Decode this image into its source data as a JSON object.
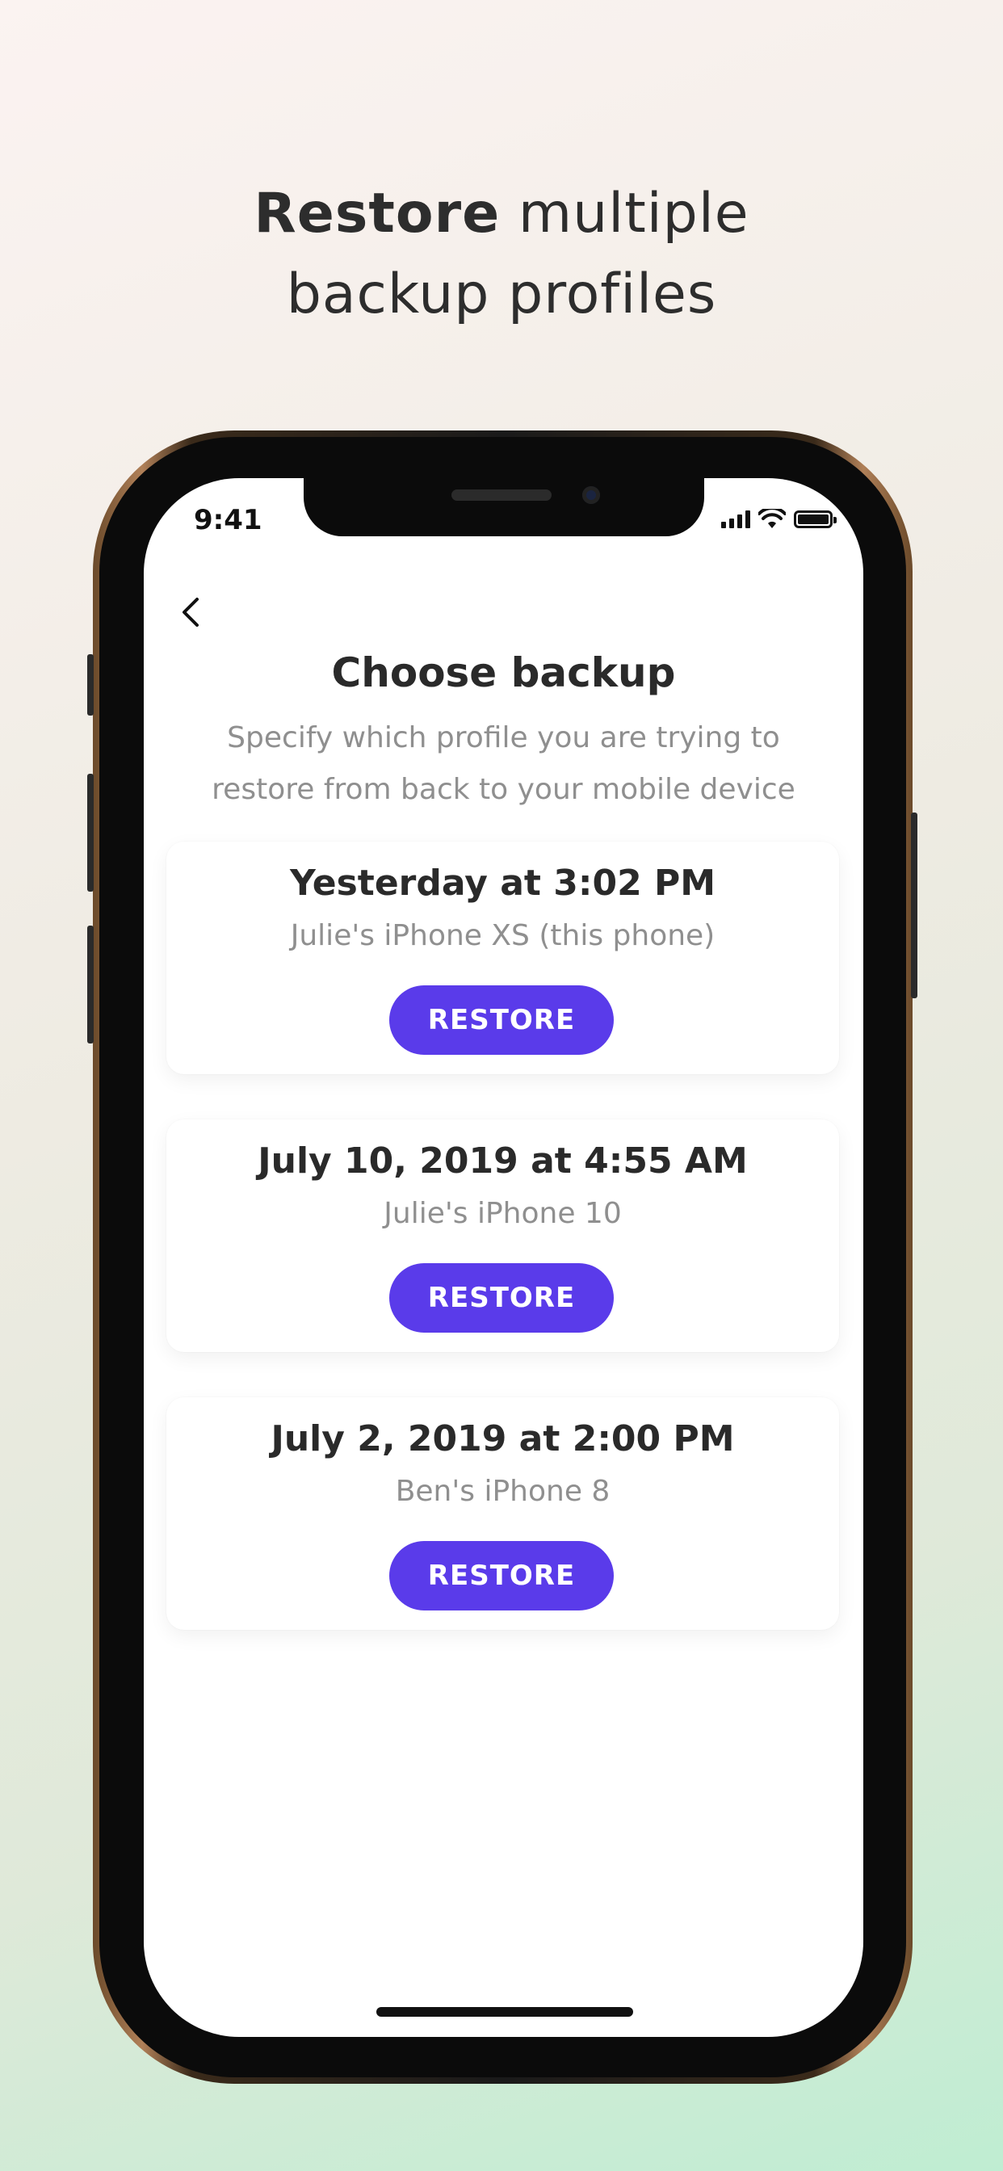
{
  "headline": {
    "bold": "Restore",
    "rest_line1": " multiple",
    "line2": "backup profiles"
  },
  "status_bar": {
    "time": "9:41"
  },
  "screen": {
    "title": "Choose backup",
    "subtitle": "Specify which profile you are trying to restore from back to your mobile device"
  },
  "backups": [
    {
      "date": "Yesterday at 3:02 PM",
      "device": "Julie's iPhone XS (this phone)",
      "button": "RESTORE"
    },
    {
      "date": "July 10, 2019 at 4:55 AM",
      "device": "Julie's iPhone 10",
      "button": "RESTORE"
    },
    {
      "date": "July 2, 2019 at 2:00 PM",
      "device": "Ben's iPhone 8",
      "button": "RESTORE"
    }
  ],
  "colors": {
    "accent": "#5a3bea",
    "title": "#2a2a2a",
    "muted": "#8f8f8f"
  },
  "icons": {
    "back": "chevron-left-icon",
    "signal": "cellular-signal-icon",
    "wifi": "wifi-icon",
    "battery": "battery-icon"
  }
}
